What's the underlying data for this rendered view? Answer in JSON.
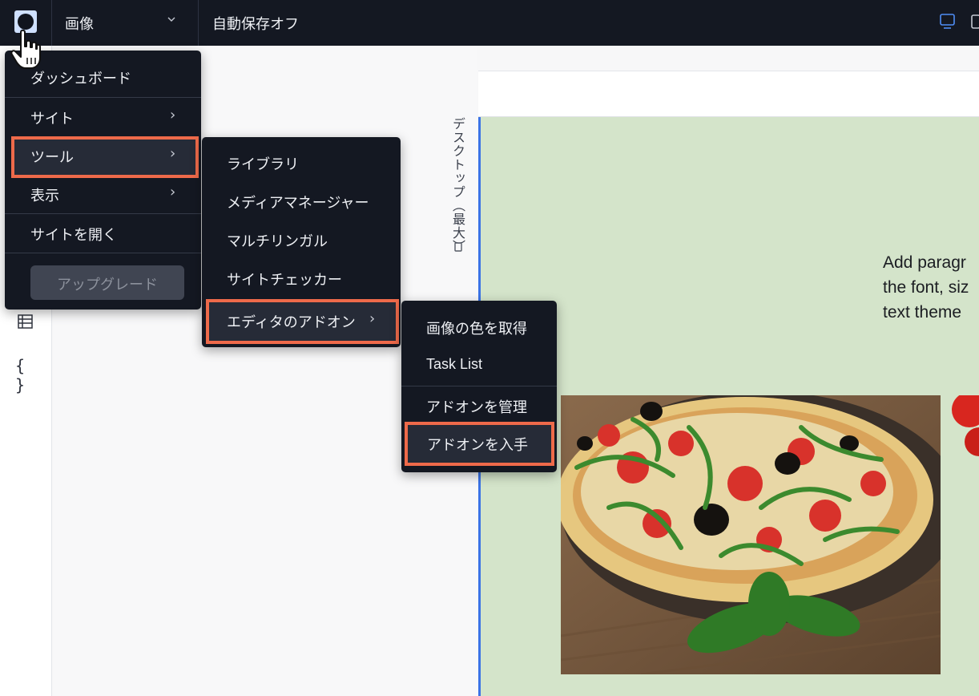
{
  "topbar": {
    "page_name": "画像",
    "autosave": "自動保存オフ"
  },
  "canvas": {
    "breakpoint_label": "デスクトップ（最大）",
    "paragraph_lines": [
      "Add paragr",
      "the font, siz",
      "text theme"
    ]
  },
  "main_menu": {
    "items": [
      {
        "label": "ダッシュボード"
      },
      {
        "label": "サイト"
      },
      {
        "label": "ツール"
      },
      {
        "label": "表示"
      },
      {
        "label": "サイトを開く"
      }
    ],
    "upgrade_label": "アップグレード"
  },
  "tools_menu": {
    "items": [
      {
        "label": "ライブラリ"
      },
      {
        "label": "メディアマネージャー"
      },
      {
        "label": "マルチリンガル"
      },
      {
        "label": "サイトチェッカー"
      },
      {
        "label": "エディタのアドオン"
      }
    ]
  },
  "addons_menu": {
    "items": [
      {
        "label": "画像の色を取得"
      },
      {
        "label": "Task List"
      },
      {
        "label": "アドオンを管理"
      },
      {
        "label": "アドオンを入手"
      }
    ]
  },
  "colors": {
    "menu_bg": "#141822",
    "highlight_border": "#ee6a4a",
    "canvas_green": "#d4e4ca",
    "selection_blue": "#3b73e6"
  }
}
